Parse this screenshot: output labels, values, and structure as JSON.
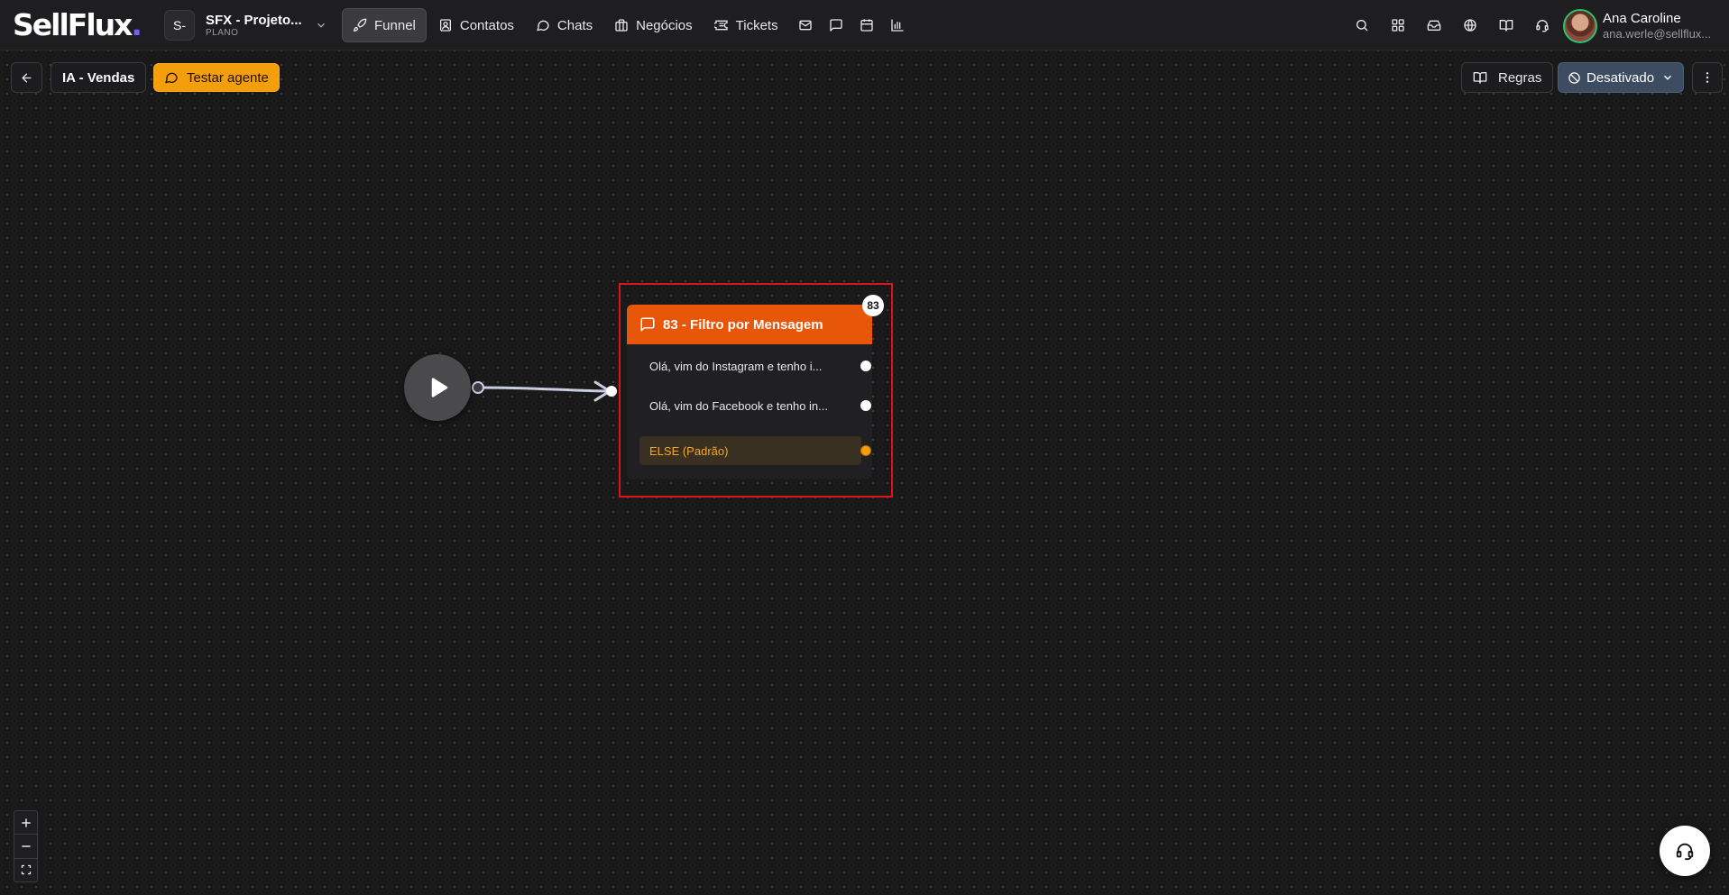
{
  "brand": {
    "logo_text": "SellFlux",
    "logo_dot": "."
  },
  "project": {
    "initials": "S-",
    "name": "SFX - Projeto...",
    "plan": "PLANO"
  },
  "nav": {
    "items": [
      {
        "label": "Funnel",
        "icon": "rocket-icon",
        "active": true
      },
      {
        "label": "Contatos",
        "icon": "contacts-icon"
      },
      {
        "label": "Chats",
        "icon": "chat-icon"
      },
      {
        "label": "Negócios",
        "icon": "briefcase-icon"
      },
      {
        "label": "Tickets",
        "icon": "ticket-icon"
      }
    ],
    "icon_items": [
      "mail-icon",
      "message-square-icon",
      "calendar-icon",
      "bar-chart-icon"
    ]
  },
  "header_right": {
    "icons": [
      "search-icon",
      "grid-icon",
      "inbox-icon",
      "globe-icon",
      "book-icon",
      "headset-icon"
    ]
  },
  "user": {
    "name": "Ana Caroline",
    "email": "ana.werle@sellflux..."
  },
  "toolbar": {
    "agent_name": "IA - Vendas",
    "test_label": "Testar agente",
    "rules_label": "Regras",
    "status_label": "Desativado"
  },
  "node": {
    "badge": "83",
    "title": "83 - Filtro por Mensagem",
    "options": [
      {
        "label": "Olá, vim do Instagram e tenho i..."
      },
      {
        "label": "Olá, vim do Facebook e tenho in..."
      },
      {
        "label": "ELSE (Padrão)",
        "default": true
      }
    ]
  },
  "zoom": {
    "in": "+",
    "out": "—"
  },
  "colors": {
    "accent_orange": "#e8560a",
    "test_button": "#f59e0b",
    "status_button": "#3e4c61",
    "highlight": "#e1121a"
  }
}
